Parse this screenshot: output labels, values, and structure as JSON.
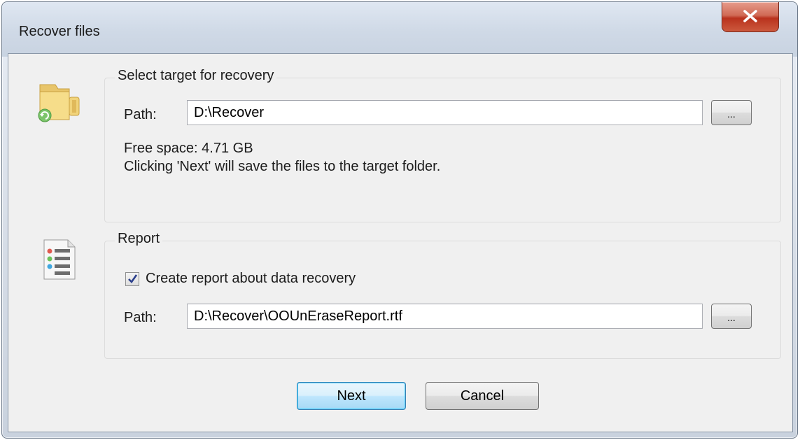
{
  "window": {
    "title": "Recover files"
  },
  "target_group": {
    "legend": "Select target for recovery",
    "path_label": "Path:",
    "path_value": "D:\\Recover",
    "browse_label": "...",
    "free_space": "Free space: 4.71 GB",
    "hint": "Clicking 'Next' will save the files to the target folder."
  },
  "report_group": {
    "legend": "Report",
    "checkbox_label": "Create report about data recovery",
    "checkbox_checked": true,
    "path_label": "Path:",
    "path_value": "D:\\Recover\\OOUnEraseReport.rtf",
    "browse_label": "..."
  },
  "buttons": {
    "next": "Next",
    "cancel": "Cancel"
  },
  "icons": {
    "target": "folder-recover-icon",
    "report": "report-list-icon",
    "close": "close-icon"
  }
}
